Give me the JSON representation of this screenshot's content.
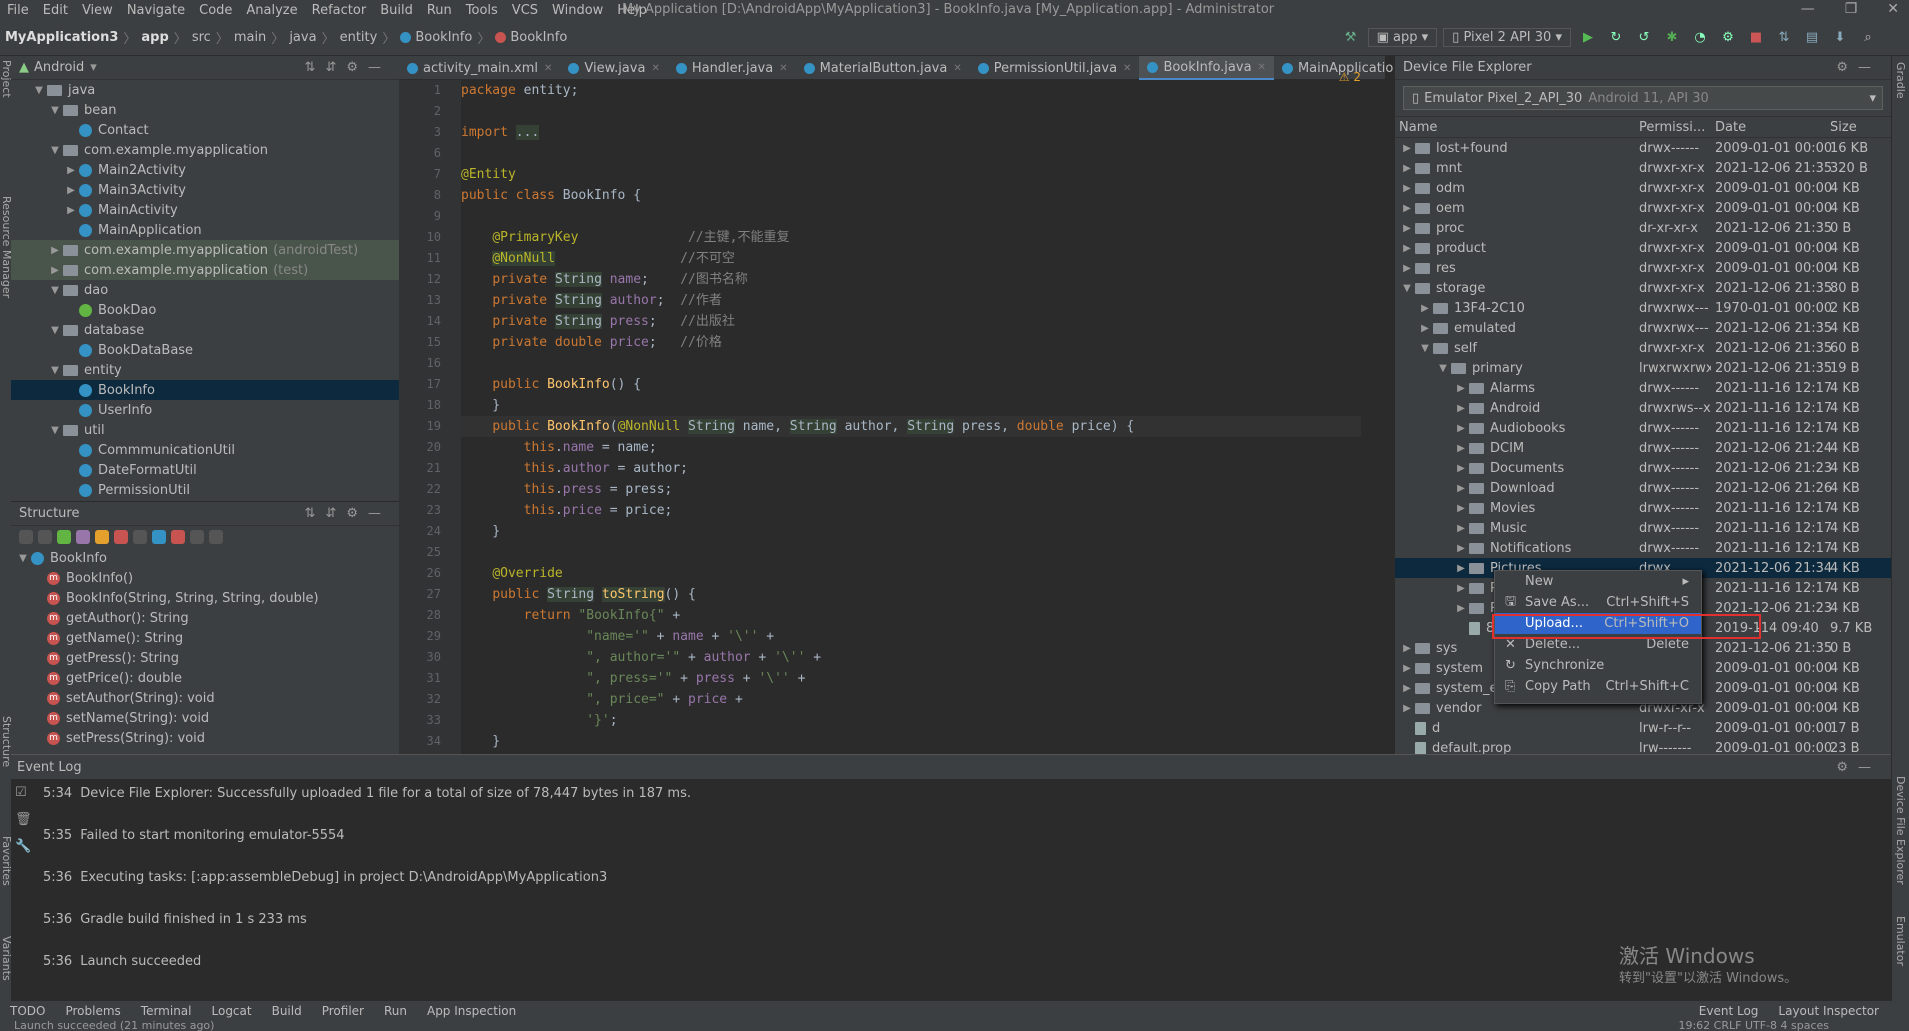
{
  "menu": [
    "File",
    "Edit",
    "View",
    "Navigate",
    "Code",
    "Analyze",
    "Refactor",
    "Build",
    "Run",
    "Tools",
    "VCS",
    "Window",
    "Help"
  ],
  "window_title": "My Application [D:\\AndroidApp\\MyApplication3] - BookInfo.java [My_Application.app] - Administrator",
  "breadcrumb": [
    "MyApplication3",
    "app",
    "src",
    "main",
    "java",
    "entity",
    "BookInfo",
    "BookInfo"
  ],
  "run_config": "app",
  "device": "Pixel 2 API 30",
  "project": {
    "view": "Android",
    "rows": [
      {
        "label": "java",
        "indent": 1,
        "type": "folder",
        "open": true
      },
      {
        "label": "bean",
        "indent": 2,
        "type": "folder",
        "open": true
      },
      {
        "label": "Contact",
        "indent": 3,
        "type": "class"
      },
      {
        "label": "com.example.myapplication",
        "indent": 2,
        "type": "folder",
        "open": true
      },
      {
        "label": "Main2Activity",
        "indent": 3,
        "type": "class",
        "arrow": true
      },
      {
        "label": "Main3Activity",
        "indent": 3,
        "type": "class",
        "arrow": true
      },
      {
        "label": "MainActivity",
        "indent": 3,
        "type": "class",
        "arrow": true
      },
      {
        "label": "MainApplication",
        "indent": 3,
        "type": "class"
      },
      {
        "label": "com.example.myapplication",
        "suffix": "(androidTest)",
        "indent": 2,
        "type": "folder",
        "test": true
      },
      {
        "label": "com.example.myapplication",
        "suffix": "(test)",
        "indent": 2,
        "type": "folder",
        "test": true
      },
      {
        "label": "dao",
        "indent": 2,
        "type": "folder",
        "open": true
      },
      {
        "label": "BookDao",
        "indent": 3,
        "type": "interface"
      },
      {
        "label": "database",
        "indent": 2,
        "type": "folder",
        "open": true
      },
      {
        "label": "BookDataBase",
        "indent": 3,
        "type": "class"
      },
      {
        "label": "entity",
        "indent": 2,
        "type": "folder",
        "open": true
      },
      {
        "label": "BookInfo",
        "indent": 3,
        "type": "class",
        "selected": true
      },
      {
        "label": "UserInfo",
        "indent": 3,
        "type": "class"
      },
      {
        "label": "util",
        "indent": 2,
        "type": "folder",
        "open": true
      },
      {
        "label": "CommmunicationUtil",
        "indent": 3,
        "type": "class"
      },
      {
        "label": "DateFormatUtil",
        "indent": 3,
        "type": "class"
      },
      {
        "label": "PermissionUtil",
        "indent": 3,
        "type": "class"
      }
    ]
  },
  "structure": {
    "title": "Structure",
    "root": "BookInfo",
    "members": [
      "BookInfo()",
      "BookInfo(String, String, String, double)",
      "getAuthor(): String",
      "getName(): String",
      "getPress(): String",
      "getPrice(): double",
      "setAuthor(String): void",
      "setName(String): void",
      "setPress(String): void"
    ]
  },
  "tabs": [
    {
      "label": "activity_main.xml"
    },
    {
      "label": "View.java"
    },
    {
      "label": "Handler.java"
    },
    {
      "label": "MaterialButton.java"
    },
    {
      "label": "PermissionUtil.java"
    },
    {
      "label": "BookInfo.java",
      "active": true
    },
    {
      "label": "MainApplication.java"
    }
  ],
  "editor": {
    "warnings": "⚠ 2",
    "line_numbers": [
      "1",
      "2",
      "3",
      "6",
      "7",
      "8",
      "9",
      "10",
      "11",
      "12",
      "13",
      "14",
      "15",
      "16",
      "17",
      "18",
      "19",
      "20",
      "21",
      "22",
      "23",
      "24",
      "25",
      "26",
      "27",
      "28",
      "29",
      "30",
      "31",
      "32",
      "33",
      "34"
    ],
    "lines": [
      "<span class='kw'>package</span> entity;",
      "",
      "<span class='kw'>import</span> <span class='hl'>...</span>",
      "",
      "<span class='an'>@Entity</span>",
      "<span class='kw'>public class</span> BookInfo {",
      "",
      "    <span class='an'>@PrimaryKey</span>              <span class='cm'>//主键,不能重复</span>",
      "    <span class='an hl'>@NonNull</span>                <span class='cm'>//不可空</span>",
      "    <span class='kw'>private</span> <span class='hl'>String</span> <span class='fd'>name</span>;    <span class='cm'>//图书名称</span>",
      "    <span class='kw'>private</span> <span class='hl'>String</span> <span class='fd'>author</span>;  <span class='cm'>//作者</span>",
      "    <span class='kw'>private</span> <span class='hl'>String</span> <span class='fd'>press</span>;   <span class='cm'>//出版社</span>",
      "    <span class='kw'>private double</span> <span class='fd'>price</span>;   <span class='cm'>//价格</span>",
      "",
      "    <span class='kw'>public</span> <span class='fn'>BookInfo</span>() {",
      "    }",
      "    <span class='kw'>public</span> <span class='fn'>BookInfo</span>(<span class='an'>@NonNull</span> <span class='hl'>String</span> name, <span class='hl'>String</span> author, <span class='hl'>String</span> press, <span class='kw'>double</span> price) {",
      "        <span class='kw'>this</span>.<span class='fd'>name</span> = name;",
      "        <span class='kw'>this</span>.<span class='fd'>author</span> = author;",
      "        <span class='kw'>this</span>.<span class='fd'>press</span> = press;",
      "        <span class='kw'>this</span>.<span class='fd'>price</span> = price;",
      "    }",
      "",
      "    <span class='an'>@Override</span>",
      "    <span class='kw'>public</span> <span class='hl'>String</span> <span class='fn hl'>toString</span>() {",
      "        <span class='kw'>return</span> <span class='st'>\"BookInfo{\"</span> +",
      "                <span class='st'>\"name='\"</span> + <span class='fd'>name</span> + <span class='st'>'\\''</span> +",
      "                <span class='st'>\", author='\"</span> + <span class='fd'>author</span> + <span class='st'>'\\''</span> +",
      "                <span class='st'>\", press='\"</span> + <span class='fd'>press</span> + <span class='st'>'\\''</span> +",
      "                <span class='st'>\", price=\"</span> + <span class='fd'>price</span> +",
      "                <span class='st'>'}'</span>;",
      "    }"
    ]
  },
  "dfe": {
    "title": "Device File Explorer",
    "device": "Emulator Pixel_2_API_30",
    "device_detail": "Android 11, API 30",
    "columns": [
      "Name",
      "Permissi...",
      "Date",
      "Size"
    ],
    "rows": [
      {
        "name": "lost+found",
        "indent": 0,
        "perm": "drwx------",
        "date": "2009-01-01 00:00",
        "size": "16 KB"
      },
      {
        "name": "mnt",
        "indent": 0,
        "perm": "drwxr-xr-x",
        "date": "2021-12-06 21:35",
        "size": "320 B"
      },
      {
        "name": "odm",
        "indent": 0,
        "perm": "drwxr-xr-x",
        "date": "2009-01-01 00:00",
        "size": "4 KB"
      },
      {
        "name": "oem",
        "indent": 0,
        "perm": "drwxr-xr-x",
        "date": "2009-01-01 00:00",
        "size": "4 KB"
      },
      {
        "name": "proc",
        "indent": 0,
        "perm": "dr-xr-xr-x",
        "date": "2021-12-06 21:35",
        "size": "0 B"
      },
      {
        "name": "product",
        "indent": 0,
        "perm": "drwxr-xr-x",
        "date": "2009-01-01 00:00",
        "size": "4 KB"
      },
      {
        "name": "res",
        "indent": 0,
        "perm": "drwxr-xr-x",
        "date": "2009-01-01 00:00",
        "size": "4 KB"
      },
      {
        "name": "storage",
        "indent": 0,
        "perm": "drwxr-xr-x",
        "date": "2021-12-06 21:35",
        "size": "80 B",
        "open": true
      },
      {
        "name": "13F4-2C10",
        "indent": 1,
        "perm": "drwxrwx---",
        "date": "1970-01-01 00:00",
        "size": "2 KB"
      },
      {
        "name": "emulated",
        "indent": 1,
        "perm": "drwxrwx---",
        "date": "2021-12-06 21:35",
        "size": "4 KB"
      },
      {
        "name": "self",
        "indent": 1,
        "perm": "drwxr-xr-x",
        "date": "2021-12-06 21:35",
        "size": "60 B",
        "open": true
      },
      {
        "name": "primary",
        "indent": 2,
        "perm": "lrwxrwxrwx",
        "date": "2021-12-06 21:35",
        "size": "19 B",
        "open": true
      },
      {
        "name": "Alarms",
        "indent": 3,
        "perm": "drwx------",
        "date": "2021-11-16 12:17",
        "size": "4 KB"
      },
      {
        "name": "Android",
        "indent": 3,
        "perm": "drwxrws--x",
        "date": "2021-11-16 12:17",
        "size": "4 KB"
      },
      {
        "name": "Audiobooks",
        "indent": 3,
        "perm": "drwx------",
        "date": "2021-11-16 12:17",
        "size": "4 KB"
      },
      {
        "name": "DCIM",
        "indent": 3,
        "perm": "drwx------",
        "date": "2021-12-06 21:24",
        "size": "4 KB"
      },
      {
        "name": "Documents",
        "indent": 3,
        "perm": "drwx------",
        "date": "2021-12-06 21:23",
        "size": "4 KB"
      },
      {
        "name": "Download",
        "indent": 3,
        "perm": "drwx------",
        "date": "2021-12-06 21:26",
        "size": "4 KB"
      },
      {
        "name": "Movies",
        "indent": 3,
        "perm": "drwx------",
        "date": "2021-11-16 12:17",
        "size": "4 KB"
      },
      {
        "name": "Music",
        "indent": 3,
        "perm": "drwx------",
        "date": "2021-11-16 12:17",
        "size": "4 KB"
      },
      {
        "name": "Notifications",
        "indent": 3,
        "perm": "drwx------",
        "date": "2021-11-16 12:17",
        "size": "4 KB"
      },
      {
        "name": "Pictures",
        "indent": 3,
        "perm": "drwx",
        "date": "2021-12-06 21:34",
        "size": "4 KB",
        "selected": true
      },
      {
        "name": "Po",
        "indent": 3,
        "perm": "",
        "date": "2021-11-16 12:17",
        "size": "4 KB"
      },
      {
        "name": "Ri",
        "indent": 3,
        "perm": "",
        "date": "2021-12-06 21:23",
        "size": "4 KB"
      },
      {
        "name": "8",
        "indent": 3,
        "perm": "",
        "date": "2019-1",
        "size": "9.7 KB",
        "file": true,
        "date2": "-14 09:40"
      },
      {
        "name": "sys",
        "indent": 0,
        "perm": "",
        "date": "2021-12-06 21:35",
        "size": "0 B"
      },
      {
        "name": "system",
        "indent": 0,
        "perm": "",
        "date": "2009-01-01 00:00",
        "size": "4 KB"
      },
      {
        "name": "system_ext",
        "indent": 0,
        "perm": "",
        "date": "2009-01-01 00:00",
        "size": "4 KB"
      },
      {
        "name": "vendor",
        "indent": 0,
        "perm": "drwxr-xr-x",
        "date": "2009-01-01 00:00",
        "size": "4 KB"
      },
      {
        "name": "d",
        "indent": 0,
        "perm": "lrw-r--r--",
        "date": "2009-01-01 00:00",
        "size": "17 B",
        "file": true
      },
      {
        "name": "default.prop",
        "indent": 0,
        "perm": "lrw-------",
        "date": "2009-01-01 00:00",
        "size": "23 B",
        "file": true
      }
    ]
  },
  "context_menu": [
    {
      "label": "New",
      "shortcut": "▸"
    },
    {
      "label": "Save As...",
      "shortcut": "Ctrl+Shift+S",
      "icon": "save-icon"
    },
    {
      "label": "Upload...",
      "shortcut": "Ctrl+Shift+O",
      "hover": true
    },
    {
      "label": "Delete...",
      "shortcut": "Delete",
      "icon": "close-icon"
    },
    {
      "label": "Synchronize",
      "shortcut": "",
      "icon": "sync-icon"
    },
    {
      "label": "Copy Path",
      "shortcut": "Ctrl+Shift+C",
      "icon": "copy-icon"
    }
  ],
  "event_log": {
    "title": "Event Log",
    "entries": [
      {
        "time": "5:34",
        "text": "Device File Explorer: Successfully uploaded 1 file for a total of size of 78,447 bytes in 187 ms."
      },
      {
        "time": "5:35",
        "text": "Failed to start monitoring emulator-5554"
      },
      {
        "time": "5:36",
        "text": "Executing tasks: [:app:assembleDebug] in project D:\\AndroidApp\\MyApplication3"
      },
      {
        "time": "5:36",
        "text": "Gradle build finished in 1 s 233 ms"
      },
      {
        "time": "5:36",
        "text": "Launch succeeded"
      }
    ]
  },
  "bottom_tools": [
    "TODO",
    "Problems",
    "Terminal",
    "Logcat",
    "Build",
    "Profiler",
    "Run",
    "App Inspection"
  ],
  "bottom_right": [
    "Event Log",
    "Layout Inspector"
  ],
  "status_left": "Launch succeeded (21 minutes ago)",
  "status_right": "19:62  CRLF  UTF-8  4 spaces",
  "watermark": {
    "line1": "激活 Windows",
    "line2": "转到\"设置\"以激活 Windows。"
  }
}
